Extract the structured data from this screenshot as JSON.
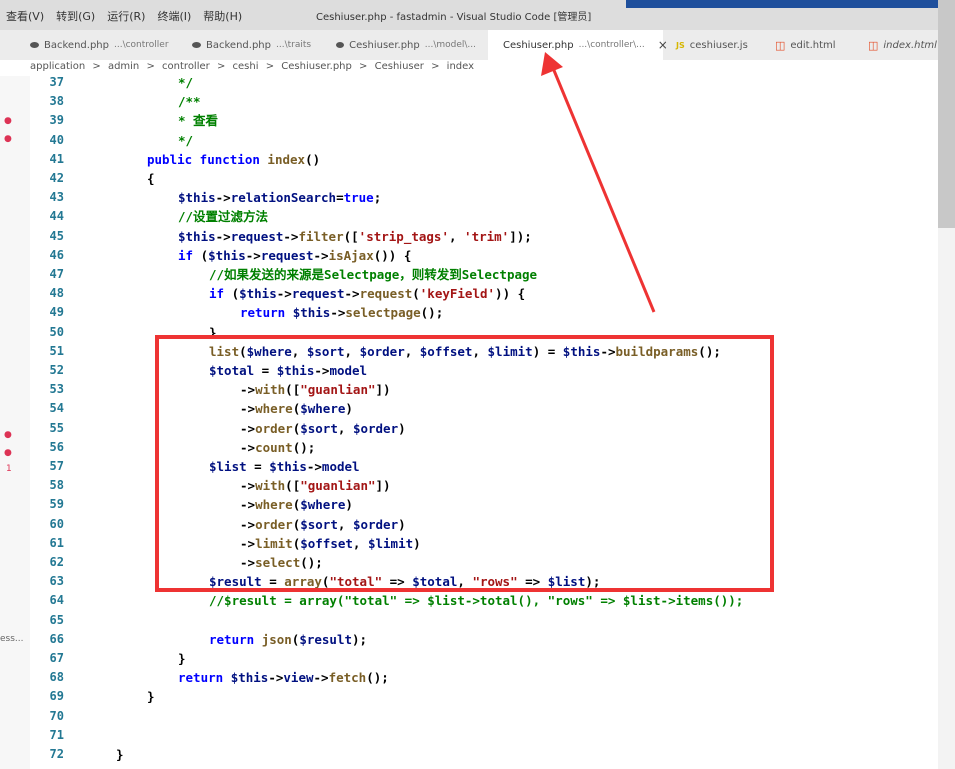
{
  "menubar": {
    "items": [
      "查看(V)",
      "转到(G)",
      "运行(R)",
      "终端(I)",
      "帮助(H)"
    ],
    "window_title": "Ceshiuser.php - fastadmin - Visual Studio Code [管理员]"
  },
  "tabs": [
    {
      "name": "Backend.php",
      "desc": "...\\controller",
      "icon": "php-icon"
    },
    {
      "name": "Backend.php",
      "desc": "...\\traits",
      "icon": "php-icon"
    },
    {
      "name": "Ceshiuser.php",
      "desc": "...\\model\\...",
      "icon": "php-icon"
    },
    {
      "name": "Ceshiuser.php",
      "desc": "...\\controller\\...",
      "icon": "php-icon",
      "active": true,
      "close": "×"
    },
    {
      "name": "ceshiuser.js",
      "desc": "",
      "icon": "js-icon",
      "badge": "JS"
    },
    {
      "name": "edit.html",
      "desc": "",
      "icon": "html-icon"
    },
    {
      "name": "index.html",
      "desc": "",
      "icon": "html-icon",
      "italic": true
    }
  ],
  "breadcrumb": [
    "application",
    ">",
    "admin",
    ">",
    "controller",
    ">",
    "ceshi",
    ">",
    "Ceshiuser.php",
    ">",
    "Ceshiuser",
    ">",
    "index"
  ],
  "code_lines": [
    {
      "n": "37",
      "indent": 3,
      "parts": [
        [
          "cm",
          "*/"
        ]
      ]
    },
    {
      "n": "38",
      "indent": 3,
      "parts": [
        [
          "cm",
          "/**"
        ]
      ]
    },
    {
      "n": "39",
      "indent": 3,
      "parts": [
        [
          "cm",
          "* 查看"
        ]
      ]
    },
    {
      "n": "40",
      "indent": 3,
      "parts": [
        [
          "cm",
          "*/"
        ]
      ]
    },
    {
      "n": "41",
      "indent": 2,
      "parts": [
        [
          "kw",
          "public function "
        ],
        [
          "fn",
          "index"
        ],
        [
          "pl",
          "()"
        ]
      ]
    },
    {
      "n": "42",
      "indent": 2,
      "parts": [
        [
          "pl",
          "{"
        ]
      ]
    },
    {
      "n": "43",
      "indent": 3,
      "parts": [
        [
          "var",
          "$this"
        ],
        [
          "pl",
          "->"
        ],
        [
          "var",
          "relationSearch"
        ],
        [
          "pl",
          "="
        ],
        [
          "kw",
          "true"
        ],
        [
          "pl",
          ";"
        ]
      ]
    },
    {
      "n": "44",
      "indent": 3,
      "parts": [
        [
          "cm",
          "//设置过滤方法"
        ]
      ]
    },
    {
      "n": "45",
      "indent": 3,
      "parts": [
        [
          "var",
          "$this"
        ],
        [
          "pl",
          "->"
        ],
        [
          "var",
          "request"
        ],
        [
          "pl",
          "->"
        ],
        [
          "fn",
          "filter"
        ],
        [
          "pl",
          "(["
        ],
        [
          "str",
          "'strip_tags'"
        ],
        [
          "pl",
          ", "
        ],
        [
          "str",
          "'trim'"
        ],
        [
          "pl",
          "]);"
        ]
      ]
    },
    {
      "n": "46",
      "indent": 3,
      "parts": [
        [
          "kw",
          "if "
        ],
        [
          "pl",
          "("
        ],
        [
          "var",
          "$this"
        ],
        [
          "pl",
          "->"
        ],
        [
          "var",
          "request"
        ],
        [
          "pl",
          "->"
        ],
        [
          "fn",
          "isAjax"
        ],
        [
          "pl",
          "()) {"
        ]
      ]
    },
    {
      "n": "47",
      "indent": 4,
      "parts": [
        [
          "cm",
          "//如果发送的来源是Selectpage，则转发到Selectpage"
        ]
      ]
    },
    {
      "n": "48",
      "indent": 4,
      "parts": [
        [
          "kw",
          "if "
        ],
        [
          "pl",
          "("
        ],
        [
          "var",
          "$this"
        ],
        [
          "pl",
          "->"
        ],
        [
          "var",
          "request"
        ],
        [
          "pl",
          "->"
        ],
        [
          "fn",
          "request"
        ],
        [
          "pl",
          "("
        ],
        [
          "str",
          "'keyField'"
        ],
        [
          "pl",
          ")) {"
        ]
      ]
    },
    {
      "n": "49",
      "indent": 5,
      "parts": [
        [
          "kw",
          "return "
        ],
        [
          "var",
          "$this"
        ],
        [
          "pl",
          "->"
        ],
        [
          "fn",
          "selectpage"
        ],
        [
          "pl",
          "();"
        ]
      ]
    },
    {
      "n": "50",
      "indent": 4,
      "parts": [
        [
          "pl",
          "}"
        ]
      ]
    },
    {
      "n": "51",
      "indent": 4,
      "parts": [
        [
          "fn",
          "list"
        ],
        [
          "pl",
          "("
        ],
        [
          "var",
          "$where"
        ],
        [
          "pl",
          ", "
        ],
        [
          "var",
          "$sort"
        ],
        [
          "pl",
          ", "
        ],
        [
          "var",
          "$order"
        ],
        [
          "pl",
          ", "
        ],
        [
          "var",
          "$offset"
        ],
        [
          "pl",
          ", "
        ],
        [
          "var",
          "$limit"
        ],
        [
          "pl",
          ") = "
        ],
        [
          "var",
          "$this"
        ],
        [
          "pl",
          "->"
        ],
        [
          "fn",
          "buildparams"
        ],
        [
          "pl",
          "();"
        ]
      ]
    },
    {
      "n": "52",
      "indent": 4,
      "parts": [
        [
          "var",
          "$total"
        ],
        [
          "pl",
          " = "
        ],
        [
          "var",
          "$this"
        ],
        [
          "pl",
          "->"
        ],
        [
          "var",
          "model"
        ]
      ]
    },
    {
      "n": "53",
      "indent": 5,
      "parts": [
        [
          "pl",
          "->"
        ],
        [
          "fn",
          "with"
        ],
        [
          "pl",
          "(["
        ],
        [
          "str",
          "\"guanlian\""
        ],
        [
          "pl",
          "])"
        ]
      ]
    },
    {
      "n": "54",
      "indent": 5,
      "parts": [
        [
          "pl",
          "->"
        ],
        [
          "fn",
          "where"
        ],
        [
          "pl",
          "("
        ],
        [
          "var",
          "$where"
        ],
        [
          "pl",
          ")"
        ]
      ]
    },
    {
      "n": "55",
      "indent": 5,
      "parts": [
        [
          "pl",
          "->"
        ],
        [
          "fn",
          "order"
        ],
        [
          "pl",
          "("
        ],
        [
          "var",
          "$sort"
        ],
        [
          "pl",
          ", "
        ],
        [
          "var",
          "$order"
        ],
        [
          "pl",
          ")"
        ]
      ]
    },
    {
      "n": "56",
      "indent": 5,
      "parts": [
        [
          "pl",
          "->"
        ],
        [
          "fn",
          "count"
        ],
        [
          "pl",
          "();"
        ]
      ]
    },
    {
      "n": "57",
      "indent": 4,
      "parts": [
        [
          "var",
          "$list"
        ],
        [
          "pl",
          " = "
        ],
        [
          "var",
          "$this"
        ],
        [
          "pl",
          "->"
        ],
        [
          "var",
          "model"
        ]
      ]
    },
    {
      "n": "58",
      "indent": 5,
      "parts": [
        [
          "pl",
          "->"
        ],
        [
          "fn",
          "with"
        ],
        [
          "pl",
          "(["
        ],
        [
          "str",
          "\"guanlian\""
        ],
        [
          "pl",
          "])"
        ]
      ]
    },
    {
      "n": "59",
      "indent": 5,
      "parts": [
        [
          "pl",
          "->"
        ],
        [
          "fn",
          "where"
        ],
        [
          "pl",
          "("
        ],
        [
          "var",
          "$where"
        ],
        [
          "pl",
          ")"
        ]
      ]
    },
    {
      "n": "60",
      "indent": 5,
      "parts": [
        [
          "pl",
          "->"
        ],
        [
          "fn",
          "order"
        ],
        [
          "pl",
          "("
        ],
        [
          "var",
          "$sort"
        ],
        [
          "pl",
          ", "
        ],
        [
          "var",
          "$order"
        ],
        [
          "pl",
          ")"
        ]
      ]
    },
    {
      "n": "61",
      "indent": 5,
      "parts": [
        [
          "pl",
          "->"
        ],
        [
          "fn",
          "limit"
        ],
        [
          "pl",
          "("
        ],
        [
          "var",
          "$offset"
        ],
        [
          "pl",
          ", "
        ],
        [
          "var",
          "$limit"
        ],
        [
          "pl",
          ")"
        ]
      ]
    },
    {
      "n": "62",
      "indent": 5,
      "parts": [
        [
          "pl",
          "->"
        ],
        [
          "fn",
          "select"
        ],
        [
          "pl",
          "();"
        ]
      ]
    },
    {
      "n": "63",
      "indent": 4,
      "parts": [
        [
          "var",
          "$result"
        ],
        [
          "pl",
          " = "
        ],
        [
          "fn",
          "array"
        ],
        [
          "pl",
          "("
        ],
        [
          "str",
          "\"total\""
        ],
        [
          "pl",
          " => "
        ],
        [
          "var",
          "$total"
        ],
        [
          "pl",
          ", "
        ],
        [
          "str",
          "\"rows\""
        ],
        [
          "pl",
          " => "
        ],
        [
          "var",
          "$list"
        ],
        [
          "pl",
          ");"
        ]
      ]
    },
    {
      "n": "64",
      "indent": 4,
      "parts": [
        [
          "cm",
          "//$result = array(\"total\" => $list->total(), \"rows\" => $list->items());"
        ]
      ]
    },
    {
      "n": "65",
      "indent": 0,
      "parts": []
    },
    {
      "n": "66",
      "indent": 4,
      "parts": [
        [
          "kw",
          "return "
        ],
        [
          "fn",
          "json"
        ],
        [
          "pl",
          "("
        ],
        [
          "var",
          "$result"
        ],
        [
          "pl",
          ");"
        ]
      ]
    },
    {
      "n": "67",
      "indent": 3,
      "parts": [
        [
          "pl",
          "}"
        ]
      ]
    },
    {
      "n": "68",
      "indent": 3,
      "parts": [
        [
          "kw",
          "return "
        ],
        [
          "var",
          "$this"
        ],
        [
          "pl",
          "->"
        ],
        [
          "var",
          "view"
        ],
        [
          "pl",
          "->"
        ],
        [
          "fn",
          "fetch"
        ],
        [
          "pl",
          "();"
        ]
      ]
    },
    {
      "n": "69",
      "indent": 2,
      "parts": [
        [
          "pl",
          "}"
        ]
      ]
    },
    {
      "n": "70",
      "indent": 0,
      "parts": []
    },
    {
      "n": "71",
      "indent": 0,
      "parts": []
    },
    {
      "n": "72",
      "indent": 1,
      "parts": [
        [
          "pl",
          "}"
        ]
      ]
    }
  ],
  "left_markers": [
    "1",
    "ess..."
  ],
  "colors": {
    "highlight": "#ee3333",
    "arrow": "#ee3333",
    "title_blue": "#1e4f9c"
  }
}
